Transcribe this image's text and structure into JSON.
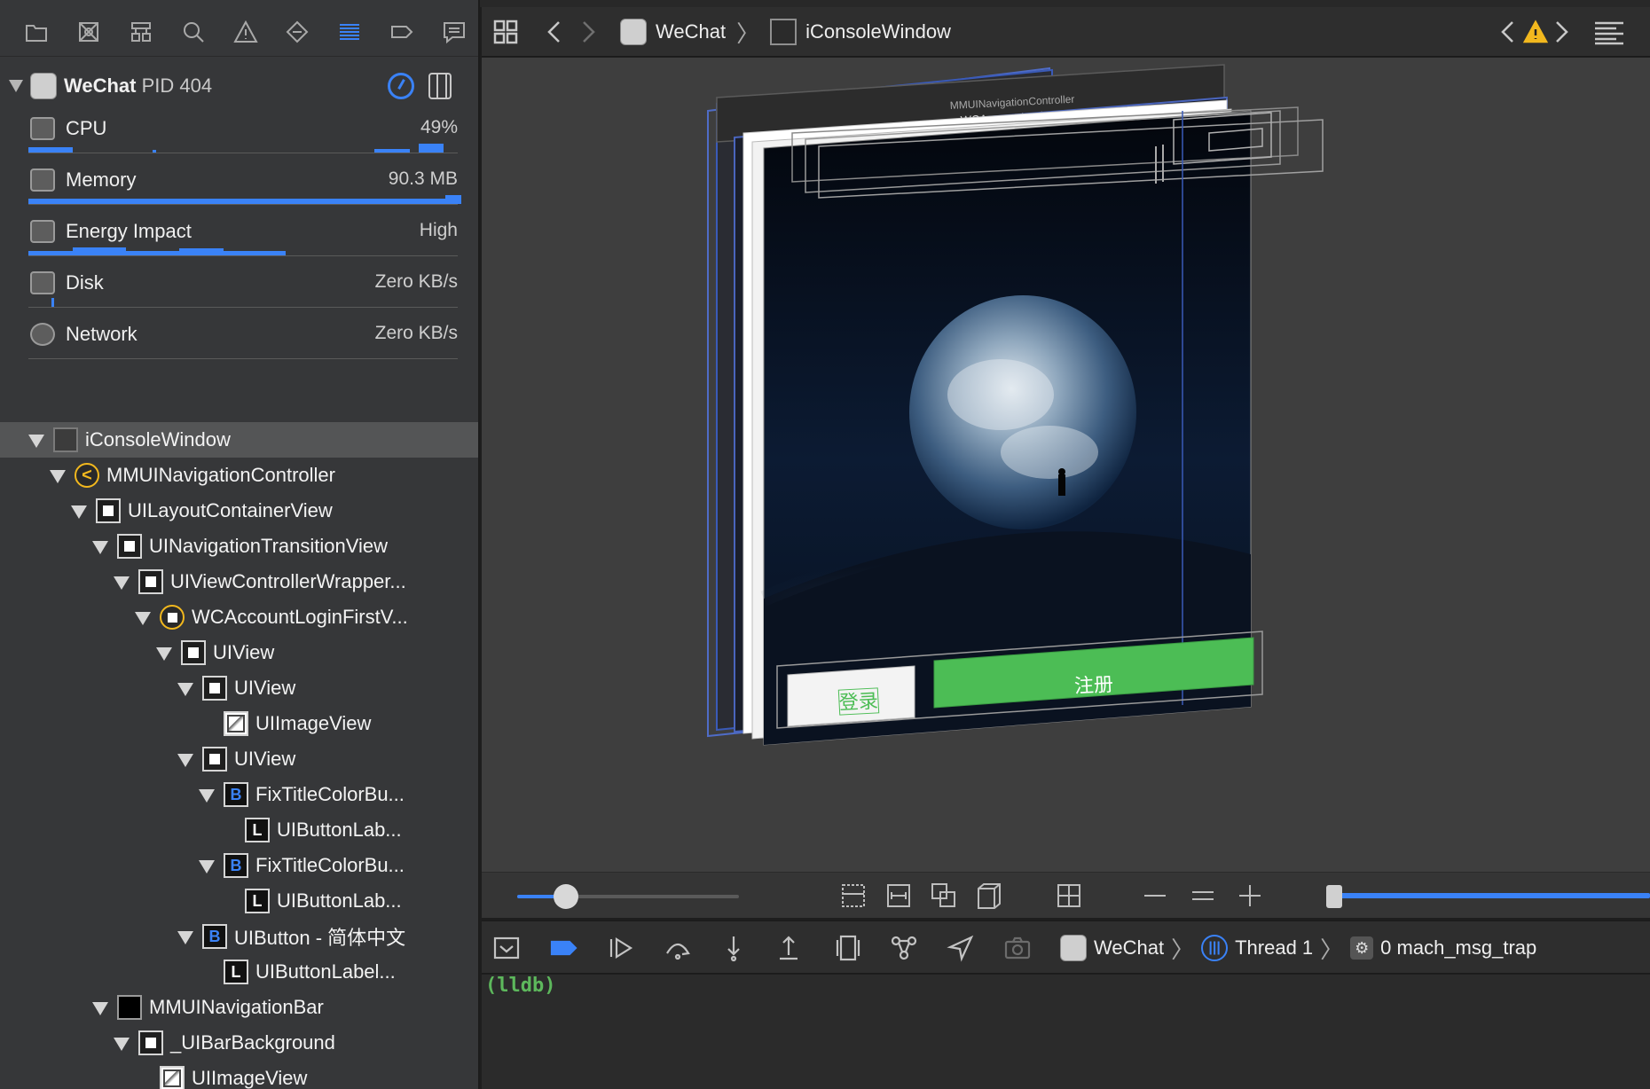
{
  "navigator": {
    "tabs": [
      "folder-icon",
      "source-control-icon",
      "hierarchy-icon",
      "search-icon",
      "warning-icon",
      "test-icon",
      "debug-icon",
      "breakpoint-icon",
      "report-icon"
    ],
    "active_tab": 6
  },
  "process": {
    "name": "WeChat",
    "pid_label": "PID 404"
  },
  "gauges": [
    {
      "name": "CPU",
      "value": "49%"
    },
    {
      "name": "Memory",
      "value": "90.3 MB"
    },
    {
      "name": "Energy Impact",
      "value": "High"
    },
    {
      "name": "Disk",
      "value": "Zero KB/s"
    },
    {
      "name": "Network",
      "value": "Zero KB/s"
    }
  ],
  "tree": [
    {
      "label": "iConsoleWindow",
      "icon": "window",
      "depth": 0,
      "open": true,
      "selected": true
    },
    {
      "label": "MMUINavigationController",
      "icon": "nav",
      "depth": 1,
      "open": true
    },
    {
      "label": "UILayoutContainerView",
      "icon": "view",
      "depth": 2,
      "open": true
    },
    {
      "label": "UINavigationTransitionView",
      "icon": "view",
      "depth": 3,
      "open": true
    },
    {
      "label": "UIViewControllerWrapper...",
      "icon": "view",
      "depth": 4,
      "open": true
    },
    {
      "label": "WCAccountLoginFirstV...",
      "icon": "vc",
      "depth": 5,
      "open": true
    },
    {
      "label": "UIView",
      "icon": "view",
      "depth": 6,
      "open": true
    },
    {
      "label": "UIView",
      "icon": "view",
      "depth": 7,
      "open": true
    },
    {
      "label": "UIImageView",
      "icon": "img",
      "depth": 8,
      "open": false
    },
    {
      "label": "UIView",
      "icon": "view",
      "depth": 7,
      "open": true
    },
    {
      "label": "FixTitleColorBu...",
      "icon": "btn",
      "depth": 8,
      "open": true
    },
    {
      "label": "UIButtonLab...",
      "icon": "lbl",
      "depth": 9,
      "open": false
    },
    {
      "label": "FixTitleColorBu...",
      "icon": "btn",
      "depth": 8,
      "open": true
    },
    {
      "label": "UIButtonLab...",
      "icon": "lbl",
      "depth": 9,
      "open": false
    },
    {
      "label": "UIButton - 简体中文",
      "icon": "btn",
      "depth": 7,
      "open": true
    },
    {
      "label": "UIButtonLabel...",
      "icon": "lbl",
      "depth": 8,
      "open": false
    },
    {
      "label": "MMUINavigationBar",
      "icon": "navbar",
      "depth": 3,
      "open": true
    },
    {
      "label": "_UIBarBackground",
      "icon": "view",
      "depth": 4,
      "open": true
    },
    {
      "label": "UIImageView",
      "icon": "img",
      "depth": 5,
      "open": false
    }
  ],
  "jumpbar": {
    "app": "WeChat",
    "window": "iConsoleWindow"
  },
  "scene": {
    "header_nav": "MMUINavigationController",
    "header_vc": "WCAccountLoginFirstViewController",
    "login_button": "登录",
    "register_button": "注册"
  },
  "debug": {
    "app": "WeChat",
    "thread": "Thread 1",
    "frame": "0 mach_msg_trap"
  },
  "console": {
    "prompt": "(lldb)"
  },
  "colors": {
    "accent": "#3a82f7",
    "warning": "#f2b81e",
    "register_green": "#4cbd55",
    "prompt_green": "#5db85c"
  }
}
